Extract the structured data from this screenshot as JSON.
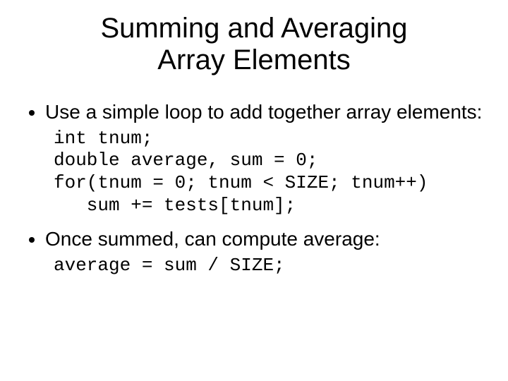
{
  "title_line1": "Summing and Averaging",
  "title_line2": "Array Elements",
  "bullets": {
    "b1": "Use a simple loop to add together array elements:",
    "b2": "Once summed, can compute average:"
  },
  "code1": {
    "l1": "int tnum;",
    "l2": "double average, sum = 0;",
    "l3": "for(tnum = 0; tnum < SIZE; tnum++)",
    "l4": "   sum += tests[tnum];"
  },
  "code2": {
    "l1": "average = sum / SIZE;"
  }
}
